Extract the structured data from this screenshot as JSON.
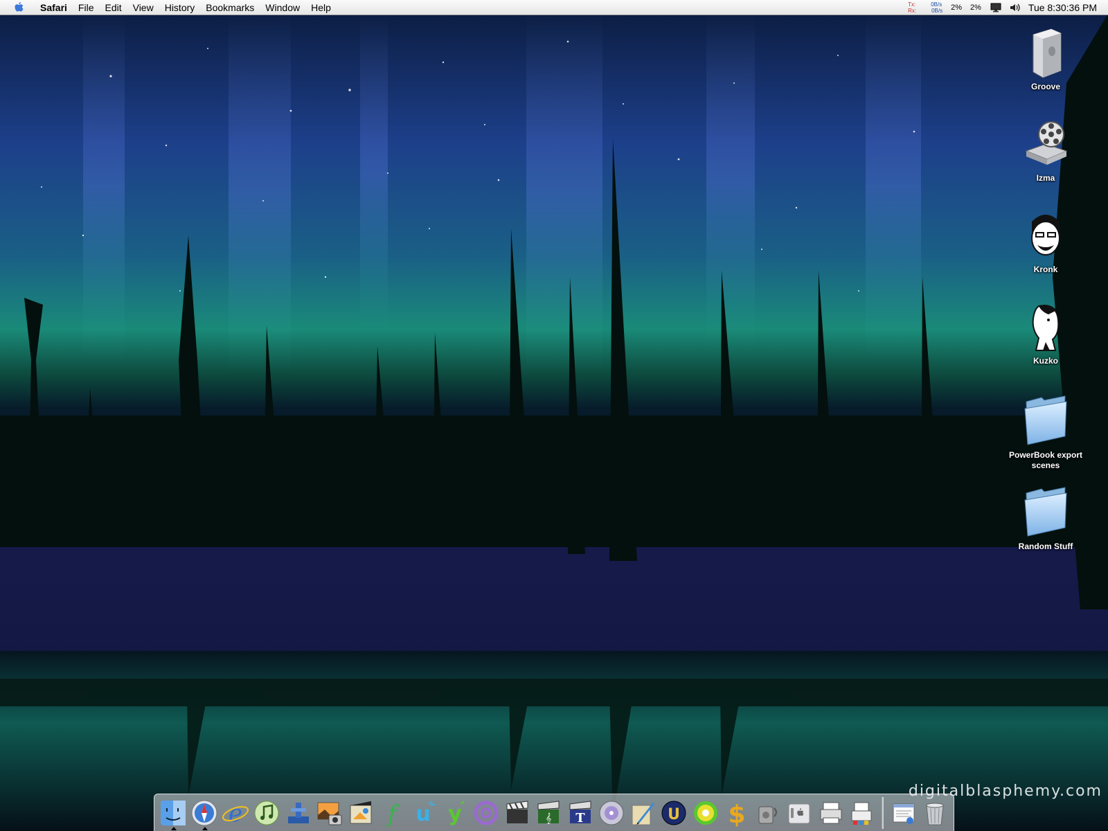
{
  "menubar": {
    "apple_icon": "apple-icon",
    "app_name": "Safari",
    "items": [
      "File",
      "Edit",
      "View",
      "History",
      "Bookmarks",
      "Window",
      "Help"
    ],
    "network": {
      "tx_label": "Tx:",
      "tx_value": "0B/s",
      "rx_label": "Rx:",
      "rx_value": "0B/s"
    },
    "cpu1": "2%",
    "cpu2": "2%",
    "display_icon": "display-icon",
    "volume_icon": "volume-icon",
    "clock": "Tue 8:30:36 PM"
  },
  "desktop": {
    "icons": [
      {
        "label": "Groove",
        "icon": "tower-computer-icon"
      },
      {
        "label": "Izma",
        "icon": "film-reel-drive-icon"
      },
      {
        "label": "Kronk",
        "icon": "cartoon-face-icon"
      },
      {
        "label": "Kuzko",
        "icon": "cartoon-profile-icon"
      },
      {
        "label": "PowerBook export scenes",
        "icon": "folder-icon"
      },
      {
        "label": "Random Stuff",
        "icon": "folder-icon"
      }
    ]
  },
  "watermark": "digitalblasphemy.com",
  "dock": {
    "apps": [
      "finder-icon",
      "safari-icon",
      "internet-explorer-icon",
      "itunes-icon",
      "xcode-icon",
      "iphoto-icon",
      "imovie-icon",
      "font-app-icon",
      "ichat-icon",
      "messenger-icon",
      "mail-icon",
      "video-clapper-icon",
      "music-clapper-icon",
      "typing-icon",
      "dvd-player-icon",
      "pen-icon",
      "unreal-icon",
      "game-disc-icon",
      "dollar-icon",
      "recycling-tool-icon",
      "system-prefs-icon",
      "printer-icon",
      "print-center-icon"
    ],
    "docs": [
      "document-icon",
      "trash-icon"
    ],
    "colors": {
      "finder": "#5aa0e8",
      "safari": "#3a7bd5",
      "ie": "#2e6fd0",
      "itunes": "#8fc85a",
      "green": "#37b34a",
      "purple": "#9a6ad0",
      "gold": "#e8a820"
    }
  }
}
